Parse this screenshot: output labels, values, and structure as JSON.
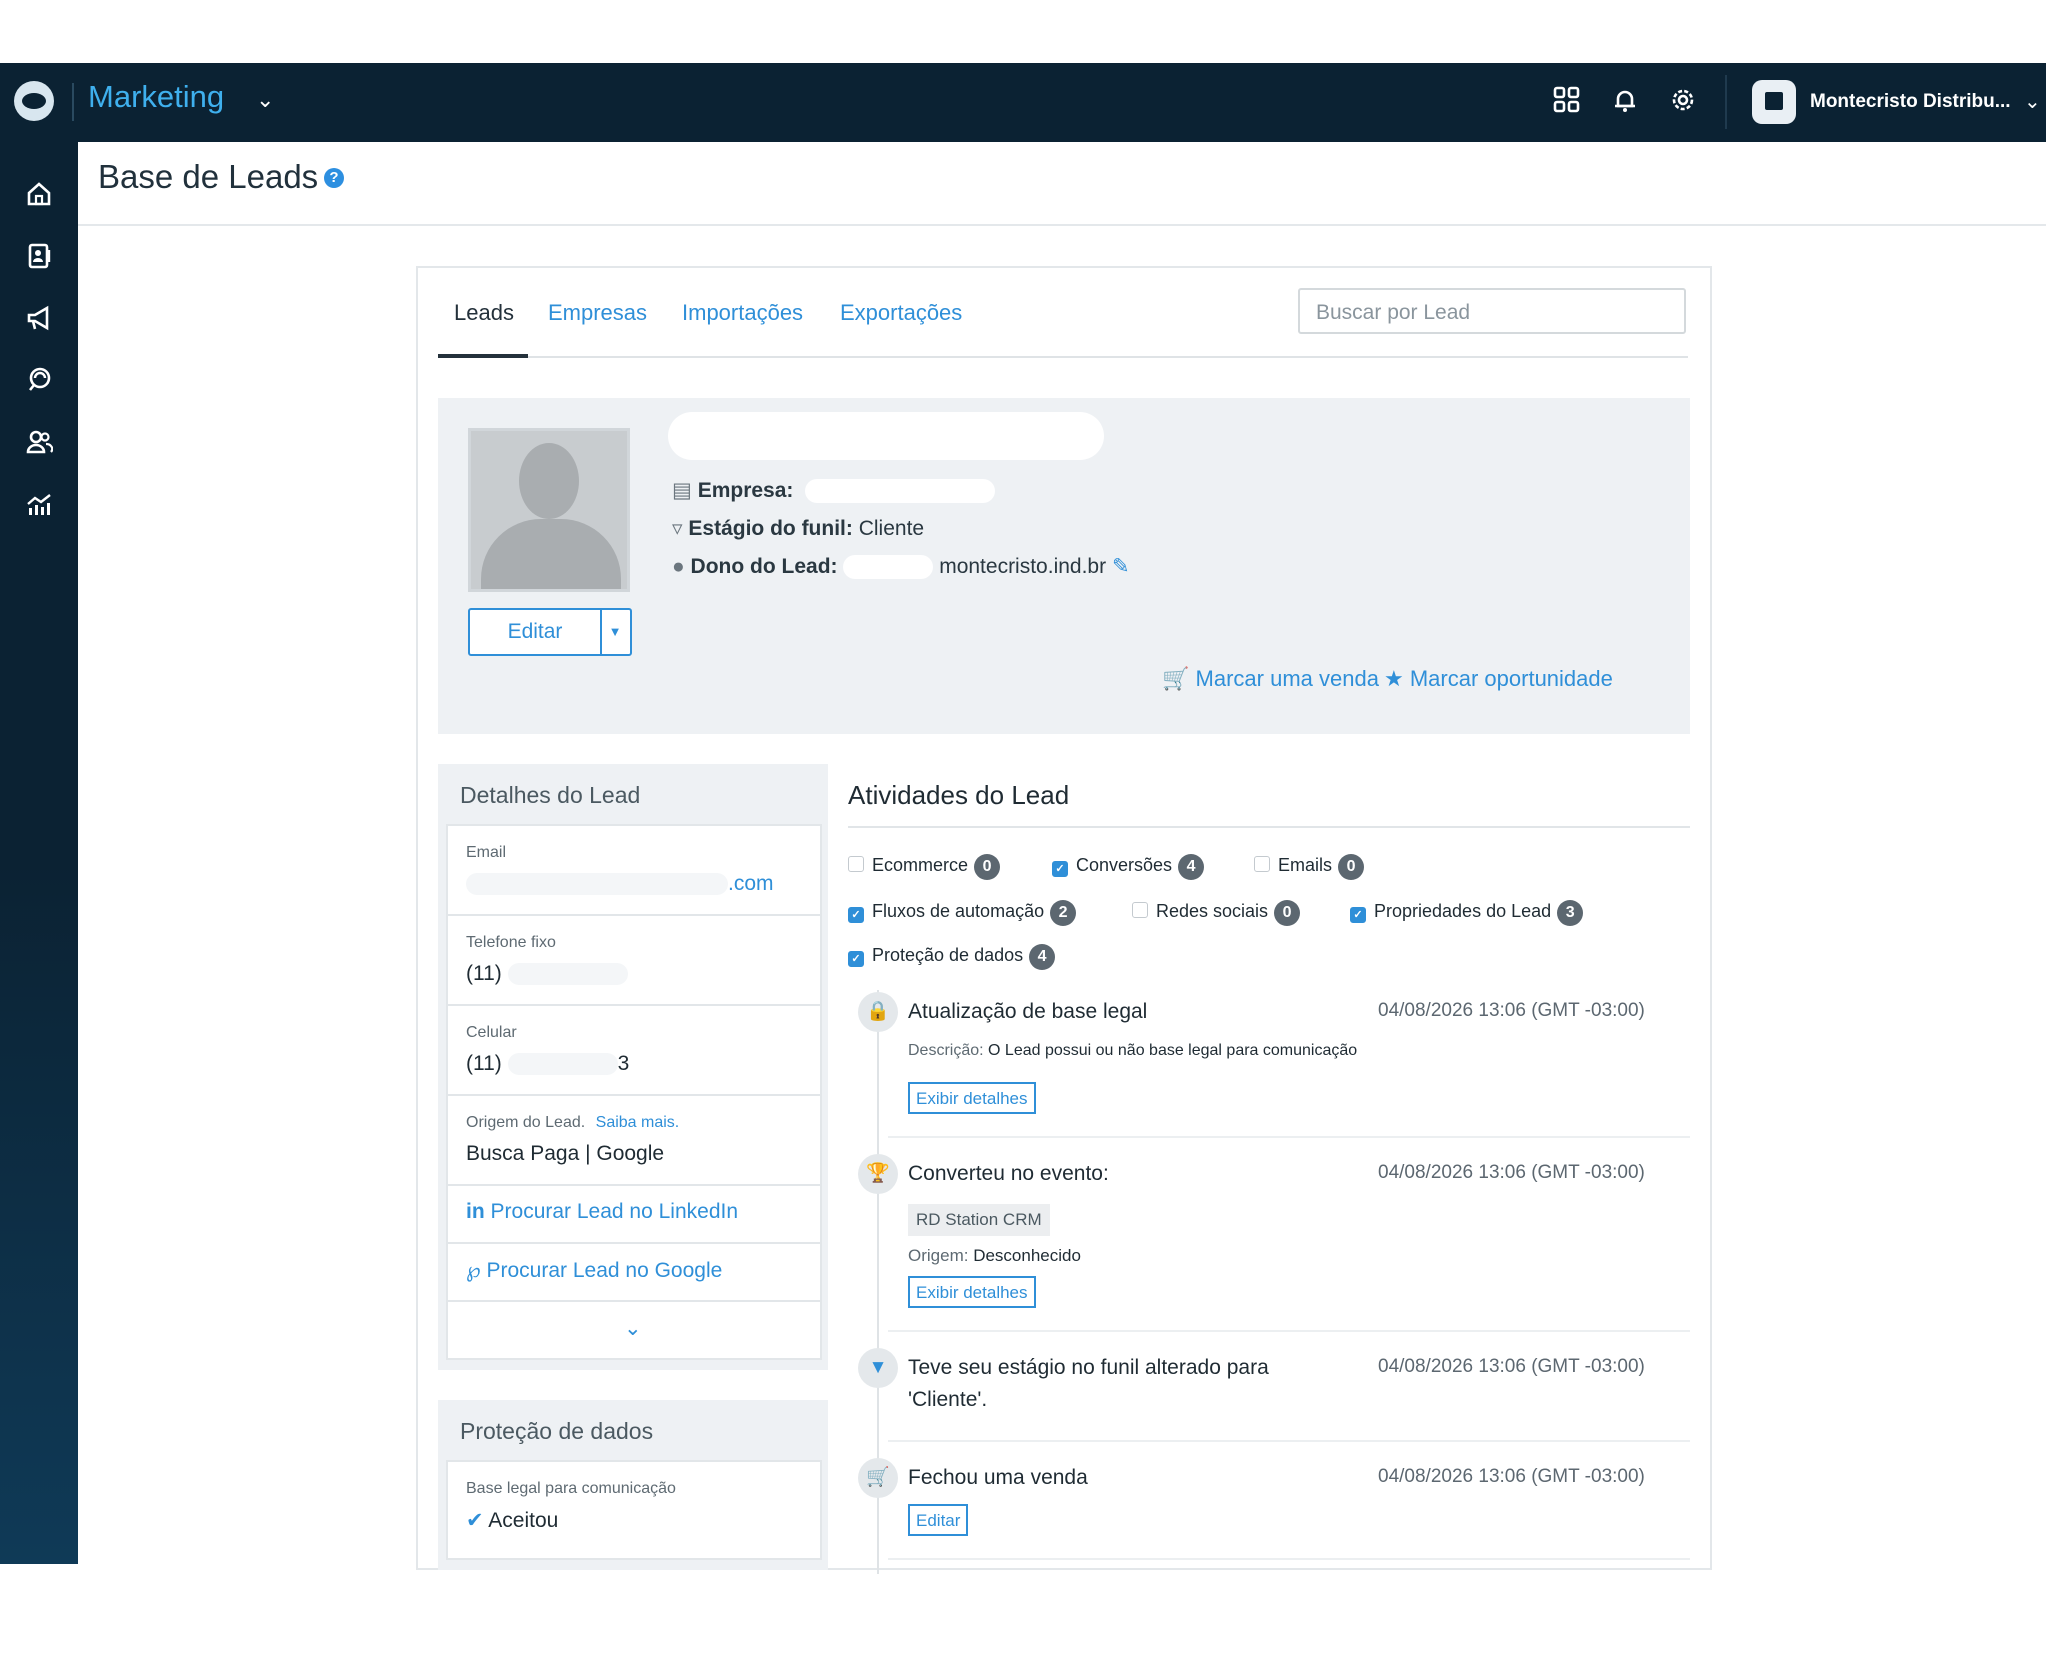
{
  "topbar": {
    "app_name": "Marketing",
    "account_name": "Montecristo Distribu..."
  },
  "header": {
    "title": "Base de Leads"
  },
  "tabs": [
    {
      "label": "Leads",
      "active": true
    },
    {
      "label": "Empresas",
      "active": false
    },
    {
      "label": "Importações",
      "active": false
    },
    {
      "label": "Exportações",
      "active": false
    }
  ],
  "search": {
    "placeholder": "Buscar por Lead"
  },
  "lead": {
    "company_label": "Empresa:",
    "stage_label": "Estágio do funil:",
    "stage_value": "Cliente",
    "owner_label": "Dono do Lead:",
    "owner_value": "montecristo.ind.br",
    "edit_label": "Editar",
    "mark_sale": "Marcar uma venda",
    "mark_opportunity": "Marcar oportunidade"
  },
  "details": {
    "title": "Detalhes do Lead",
    "email_label": "Email",
    "email_value": ".com",
    "phone_label": "Telefone fixo",
    "phone_value": "(11)",
    "mobile_label": "Celular",
    "mobile_value": "(11)",
    "mobile_suffix": "3",
    "origin_label": "Origem do Lead.",
    "origin_link": "Saiba mais.",
    "origin_value": "Busca Paga | Google",
    "linkedin_link": "Procurar Lead no LinkedIn",
    "google_link": "Procurar Lead no Google"
  },
  "protection": {
    "title": "Proteção de dados",
    "legal_label": "Base legal para comunicação",
    "legal_value": "Aceitou"
  },
  "activities": {
    "title": "Atividades do Lead",
    "filters": [
      {
        "label": "Ecommerce",
        "count": "0",
        "checked": false
      },
      {
        "label": "Conversões",
        "count": "4",
        "checked": true
      },
      {
        "label": "Emails",
        "count": "0",
        "checked": false
      },
      {
        "label": "Fluxos de automação",
        "count": "2",
        "checked": true
      },
      {
        "label": "Redes sociais",
        "count": "0",
        "checked": false
      },
      {
        "label": "Propriedades do Lead",
        "count": "3",
        "checked": true
      },
      {
        "label": "Proteção de dados",
        "count": "4",
        "checked": true
      }
    ],
    "events": [
      {
        "title": "Atualização de base legal",
        "time": "04/08/2026 13:06 (GMT -03:00)",
        "desc_label": "Descrição:",
        "desc_value": "O Lead possui ou não base legal para comunicação",
        "button": "Exibir detalhes",
        "icon": "lock-icon"
      },
      {
        "title": "Converteu no evento:",
        "time": "04/08/2026 13:06 (GMT -03:00)",
        "tag": "RD Station CRM",
        "origin_label": "Origem:",
        "origin_value": "Desconhecido",
        "button": "Exibir detalhes",
        "icon": "trophy-icon"
      },
      {
        "title": "Teve seu estágio no funil alterado para",
        "title_line2": "'Cliente'.",
        "time": "04/08/2026 13:06 (GMT -03:00)",
        "icon": "funnel-icon"
      },
      {
        "title": "Fechou uma venda",
        "time": "04/08/2026 13:06 (GMT -03:00)",
        "button": "Editar",
        "icon": "cart-icon"
      }
    ]
  }
}
